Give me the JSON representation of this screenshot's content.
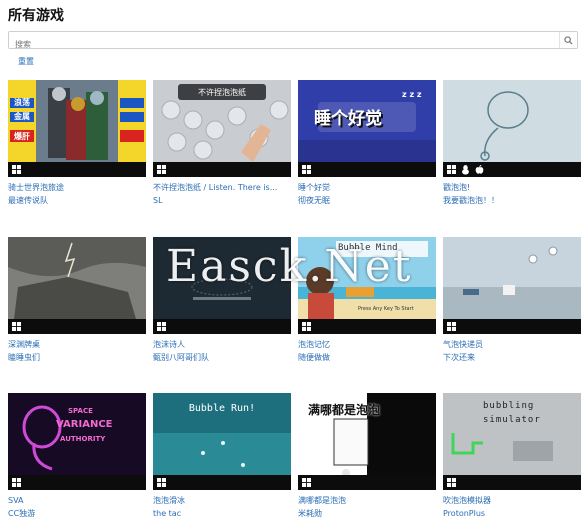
{
  "page_title": "所有游戏",
  "search": {
    "placeholder": "搜索"
  },
  "reset_label": "重置",
  "games": [
    {
      "title": "骑士世界泡旅途",
      "developer": "最速传说队",
      "platforms": [
        "windows-icon"
      ],
      "thumb_text": [
        "浪荡",
        "金属",
        "爆肝"
      ]
    },
    {
      "title": "不许捏泡泡纸 / Listen. There is...",
      "developer": "SL",
      "platforms": [
        "windows-icon"
      ],
      "thumb_text": [
        "不许捏泡泡纸"
      ]
    },
    {
      "title": "睡个好觉",
      "developer": "彻夜无眠",
      "platforms": [
        "windows-icon"
      ],
      "thumb_text": [
        "睡个好觉",
        "z z z"
      ]
    },
    {
      "title": "戳泡泡!",
      "developer": "我要戳泡泡！！",
      "platforms": [
        "windows-icon",
        "linux-icon",
        "apple-icon"
      ],
      "thumb_text": []
    },
    {
      "title": "深渊牌桌",
      "developer": "瞌睡虫们",
      "platforms": [
        "windows-icon"
      ],
      "thumb_text": []
    },
    {
      "title": "泡沫诗人",
      "developer": "甄别八阿哥们队",
      "platforms": [
        "windows-icon"
      ],
      "thumb_text": []
    },
    {
      "title": "泡泡记忆",
      "developer": "随便做做",
      "platforms": [
        "windows-icon"
      ],
      "thumb_text": [
        "Bubble Mind",
        "Press Any Key To Start"
      ]
    },
    {
      "title": "气泡快递员",
      "developer": "下次还来",
      "platforms": [
        "windows-icon"
      ],
      "thumb_text": []
    },
    {
      "title": "SVA",
      "developer": "CC独游",
      "platforms": [
        "windows-icon"
      ],
      "thumb_text": [
        "SPACE",
        "VARIANCE",
        "AUTHORITY"
      ]
    },
    {
      "title": "泡泡滑冰",
      "developer": "the tac",
      "platforms": [
        "windows-icon"
      ],
      "thumb_text": [
        "Bubble Run!"
      ]
    },
    {
      "title": "满哪都是泡泡",
      "developer": "米耗勋",
      "platforms": [
        "windows-icon"
      ],
      "thumb_text": [
        "满哪都是泡泡"
      ]
    },
    {
      "title": "吹泡泡模拟器",
      "developer": "ProtonPlus",
      "platforms": [
        "windows-icon"
      ],
      "thumb_text": [
        "bubbling",
        "simulator"
      ]
    }
  ],
  "watermark": "Easck.Net"
}
